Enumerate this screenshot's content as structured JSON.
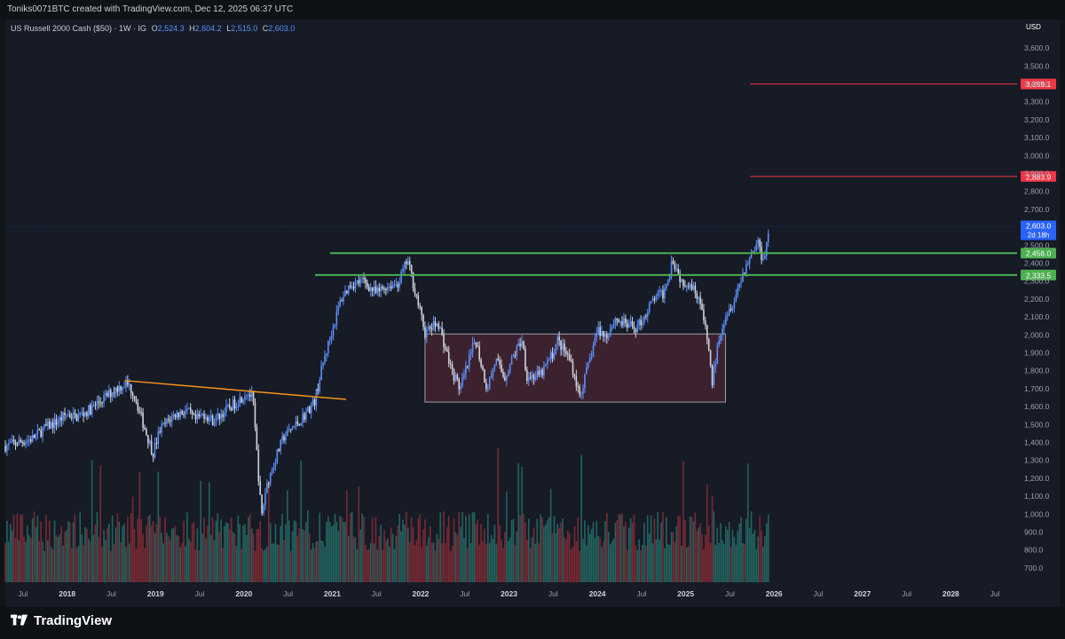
{
  "header": {
    "attribution": "Toniks0071BTC created with TradingView.com, Dec 12, 2025 06:37 UTC"
  },
  "legend": {
    "symbol": "US Russell 2000 Cash ($50) · 1W · IG",
    "open_label": "O",
    "open": "2,524.3",
    "high_label": "H",
    "high": "2,604.2",
    "low_label": "L",
    "low": "2,515.0",
    "close_label": "C",
    "close": "2,603.0"
  },
  "axis": {
    "currency": "USD"
  },
  "footer": {
    "logo_text": "TradingView"
  },
  "colors": {
    "up": "#5b8ff9",
    "down": "#d1d4dc",
    "vol_up": "#26706a",
    "vol_down": "#8a2d36",
    "resistance": "#f23645",
    "support": "#4caf50",
    "trendline": "#f7931a",
    "range_box": "#4a2631"
  },
  "chart_data": {
    "type": "candlestick",
    "timeframe": "1W",
    "ylim": [
      650,
      3650
    ],
    "y_ticks": [
      "3,600.0",
      "3,500.0",
      "3,400.0",
      "3,300.0",
      "3,200.0",
      "3,100.0",
      "3,000.0",
      "2,900.0",
      "2,800.0",
      "2,700.0",
      "2,600.0",
      "2,500.0",
      "2,400.0",
      "2,300.0",
      "2,200.0",
      "2,100.0",
      "2,000.0",
      "1,900.0",
      "1,800.0",
      "1,700.0",
      "1,600.0",
      "1,500.0",
      "1,400.0",
      "1,300.0",
      "1,200.0",
      "1,100.0",
      "1,000.0",
      "900.0",
      "800.0",
      "700.0"
    ],
    "x_ticks": [
      {
        "label": "Jul",
        "year": false,
        "t": 2017.5
      },
      {
        "label": "2018",
        "year": true,
        "t": 2018.0
      },
      {
        "label": "Jul",
        "year": false,
        "t": 2018.5
      },
      {
        "label": "2019",
        "year": true,
        "t": 2019.0
      },
      {
        "label": "Jul",
        "year": false,
        "t": 2019.5
      },
      {
        "label": "2020",
        "year": true,
        "t": 2020.0
      },
      {
        "label": "Jul",
        "year": false,
        "t": 2020.5
      },
      {
        "label": "2021",
        "year": true,
        "t": 2021.0
      },
      {
        "label": "Jul",
        "year": false,
        "t": 2021.5
      },
      {
        "label": "2022",
        "year": true,
        "t": 2022.0
      },
      {
        "label": "Jul",
        "year": false,
        "t": 2022.5
      },
      {
        "label": "2023",
        "year": true,
        "t": 2023.0
      },
      {
        "label": "Jul",
        "year": false,
        "t": 2023.5
      },
      {
        "label": "2024",
        "year": true,
        "t": 2024.0
      },
      {
        "label": "Jul",
        "year": false,
        "t": 2024.5
      },
      {
        "label": "2025",
        "year": true,
        "t": 2025.0
      },
      {
        "label": "Jul",
        "year": false,
        "t": 2025.5
      },
      {
        "label": "2026",
        "year": true,
        "t": 2026.0
      },
      {
        "label": "Jul",
        "year": false,
        "t": 2026.5
      },
      {
        "label": "2027",
        "year": true,
        "t": 2027.0
      },
      {
        "label": "Jul",
        "year": false,
        "t": 2027.5
      },
      {
        "label": "2028",
        "year": true,
        "t": 2028.0
      },
      {
        "label": "Jul",
        "year": false,
        "t": 2028.5
      }
    ],
    "price_path": [
      [
        2017.3,
        1380
      ],
      [
        2017.45,
        1400
      ],
      [
        2017.6,
        1420
      ],
      [
        2017.75,
        1480
      ],
      [
        2017.9,
        1520
      ],
      [
        2018.0,
        1560
      ],
      [
        2018.1,
        1540
      ],
      [
        2018.25,
        1580
      ],
      [
        2018.4,
        1640
      ],
      [
        2018.55,
        1700
      ],
      [
        2018.67,
        1730
      ],
      [
        2018.75,
        1680
      ],
      [
        2018.85,
        1520
      ],
      [
        2018.97,
        1340
      ],
      [
        2019.05,
        1470
      ],
      [
        2019.2,
        1550
      ],
      [
        2019.35,
        1580
      ],
      [
        2019.45,
        1520
      ],
      [
        2019.55,
        1560
      ],
      [
        2019.65,
        1520
      ],
      [
        2019.75,
        1560
      ],
      [
        2019.85,
        1600
      ],
      [
        2019.95,
        1640
      ],
      [
        2020.03,
        1680
      ],
      [
        2020.1,
        1650
      ],
      [
        2020.2,
        980
      ],
      [
        2020.25,
        1150
      ],
      [
        2020.35,
        1300
      ],
      [
        2020.45,
        1430
      ],
      [
        2020.55,
        1480
      ],
      [
        2020.65,
        1530
      ],
      [
        2020.8,
        1630
      ],
      [
        2020.9,
        1850
      ],
      [
        2021.0,
        2030
      ],
      [
        2021.1,
        2200
      ],
      [
        2021.2,
        2280
      ],
      [
        2021.35,
        2300
      ],
      [
        2021.5,
        2230
      ],
      [
        2021.6,
        2270
      ],
      [
        2021.75,
        2290
      ],
      [
        2021.85,
        2420
      ],
      [
        2021.95,
        2220
      ],
      [
        2022.05,
        2010
      ],
      [
        2022.2,
        2070
      ],
      [
        2022.35,
        1800
      ],
      [
        2022.45,
        1700
      ],
      [
        2022.55,
        1860
      ],
      [
        2022.62,
        1980
      ],
      [
        2022.75,
        1700
      ],
      [
        2022.85,
        1860
      ],
      [
        2022.95,
        1760
      ],
      [
        2023.05,
        1880
      ],
      [
        2023.15,
        1980
      ],
      [
        2023.2,
        1770
      ],
      [
        2023.35,
        1770
      ],
      [
        2023.5,
        1900
      ],
      [
        2023.55,
        1970
      ],
      [
        2023.7,
        1850
      ],
      [
        2023.8,
        1660
      ],
      [
        2023.9,
        1830
      ],
      [
        2024.0,
        2030
      ],
      [
        2024.1,
        1990
      ],
      [
        2024.2,
        2090
      ],
      [
        2024.35,
        2050
      ],
      [
        2024.45,
        2040
      ],
      [
        2024.55,
        2120
      ],
      [
        2024.65,
        2210
      ],
      [
        2024.75,
        2230
      ],
      [
        2024.85,
        2430
      ],
      [
        2024.95,
        2300
      ],
      [
        2025.05,
        2290
      ],
      [
        2025.15,
        2210
      ],
      [
        2025.25,
        1960
      ],
      [
        2025.3,
        1730
      ],
      [
        2025.38,
        2000
      ],
      [
        2025.45,
        2110
      ],
      [
        2025.55,
        2200
      ],
      [
        2025.65,
        2350
      ],
      [
        2025.75,
        2460
      ],
      [
        2025.82,
        2520
      ],
      [
        2025.87,
        2420
      ],
      [
        2025.92,
        2520
      ],
      [
        2025.95,
        2603
      ]
    ],
    "last_price": "2,603.0",
    "countdown": "2d 18h",
    "horizontal_levels": [
      {
        "price": 3399.1,
        "label": "3,399.1",
        "kind": "resistance"
      },
      {
        "price": 2883.9,
        "label": "2,883.9",
        "kind": "resistance"
      },
      {
        "price": 2456.0,
        "label": "2,456.0",
        "kind": "support"
      },
      {
        "price": 2333.5,
        "label": "2,333.5",
        "kind": "support"
      }
    ],
    "trendline": {
      "from": [
        2018.65,
        1745
      ],
      "to": [
        2021.05,
        1640
      ]
    },
    "range_box": {
      "t0": 2022.05,
      "t1": 2025.45,
      "p0": 1625,
      "p1": 2005
    },
    "grid": false,
    "legend": "top-left"
  }
}
